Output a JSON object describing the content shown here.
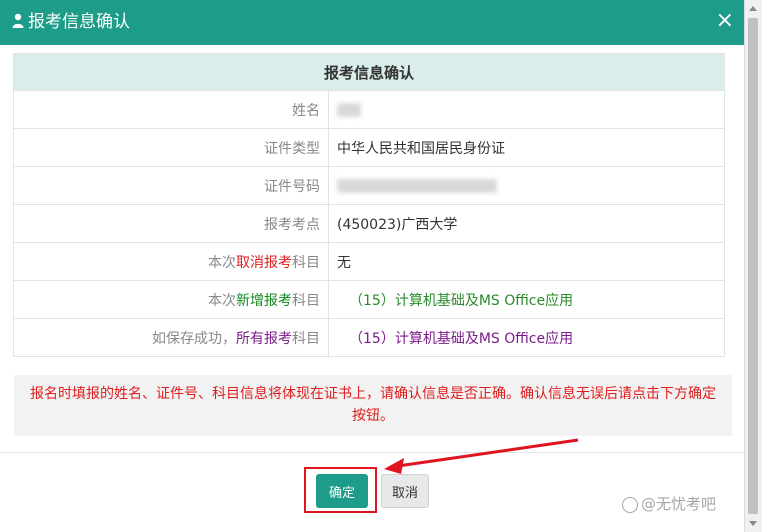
{
  "dialog": {
    "title": "报考信息确认",
    "close_symbol": "×",
    "user_icon": "user-icon"
  },
  "table": {
    "header": "报考信息确认",
    "rows": {
      "name_label": "姓名",
      "id_type_label": "证件类型",
      "id_type_value": "中华人民共和国居民身份证",
      "id_number_label": "证件号码",
      "exam_site_label": "报考考点",
      "exam_site_value": "(450023)广西大学",
      "cancel_label_pre": "本次",
      "cancel_label_red": "取消报考",
      "cancel_label_post": "科目",
      "cancel_value": "无",
      "new_label_pre": "本次",
      "new_label_green": "新增报考",
      "new_label_post": "科目",
      "new_value": "（15）计算机基础及MS Office应用",
      "all_label_pre": "如保存成功，",
      "all_label_purple": "所有报考",
      "all_label_post": "科目",
      "all_value": "（15）计算机基础及MS Office应用"
    }
  },
  "notice": "报名时填报的姓名、证件号、科目信息将体现在证书上，请确认信息是否正确。确认信息无误后请点击下方确定按钮。",
  "buttons": {
    "confirm": "确定",
    "cancel": "取消"
  },
  "watermark": "@无忧考吧",
  "colors": {
    "header": "#1d9c8a",
    "table_head": "#d9eeeb",
    "red": "#e01c1c",
    "green": "#2a8a2a",
    "purple": "#7b1c8a",
    "annotation": "#e0141e"
  }
}
